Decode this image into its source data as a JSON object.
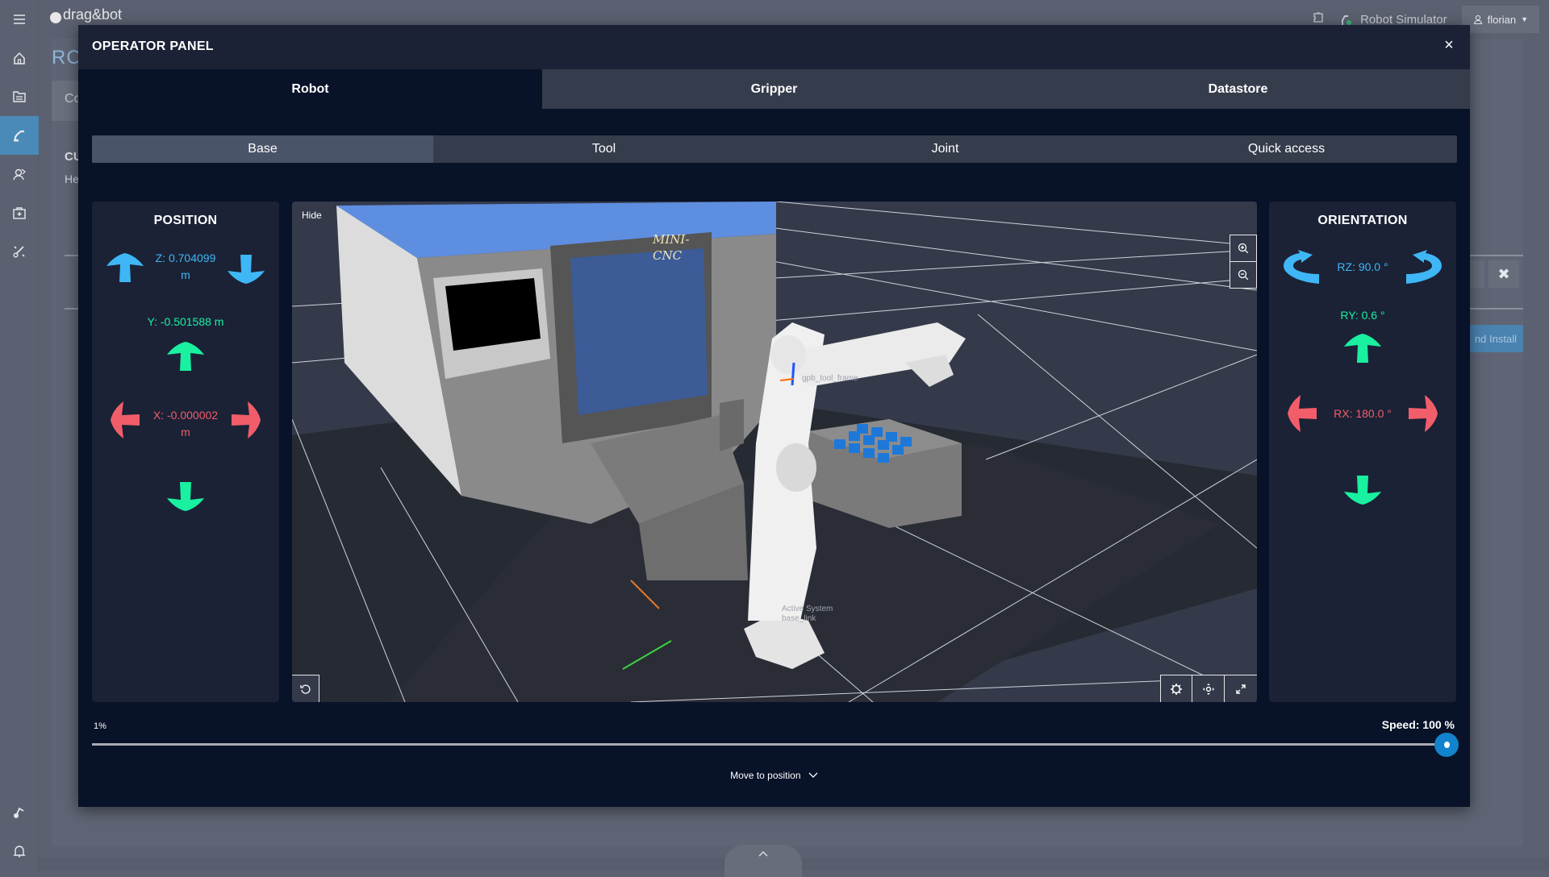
{
  "app": {
    "logo_text": "drag&bot",
    "page_title_partial": "RO",
    "card_text_partial": "Co",
    "section_title_partial": "CU",
    "section_sub_partial": "He",
    "install_button_partial": "nd Install",
    "robot_name": "Robot Simulator",
    "user_name": "florian"
  },
  "sidebar": {
    "items": [
      {
        "icon": "menu-icon"
      },
      {
        "icon": "home-icon"
      },
      {
        "icon": "program-list-icon"
      },
      {
        "icon": "robot-arm-icon",
        "active": true
      },
      {
        "icon": "skills-icon"
      },
      {
        "icon": "toolbox-icon"
      },
      {
        "icon": "tools-icon"
      },
      {
        "icon": "logo-small-icon"
      },
      {
        "icon": "bell-icon"
      }
    ]
  },
  "modal": {
    "title": "OPERATOR PANEL",
    "close_label": "×",
    "tabs": [
      {
        "label": "Robot",
        "active": true
      },
      {
        "label": "Gripper",
        "active": false
      },
      {
        "label": "Datastore",
        "active": false
      }
    ],
    "sub_tabs": [
      {
        "label": "Base",
        "active": true
      },
      {
        "label": "Tool",
        "active": false
      },
      {
        "label": "Joint",
        "active": false
      },
      {
        "label": "Quick access",
        "active": false
      }
    ]
  },
  "position": {
    "title": "POSITION",
    "z_label": "Z: 0.704099",
    "z_unit": "m",
    "y_label": "Y: -0.501588 m",
    "x_label": "X: -0.000002",
    "x_unit": "m"
  },
  "orientation": {
    "title": "ORIENTATION",
    "rz_label": "RZ: 90.0 °",
    "ry_label": "RY: 0.6 °",
    "rx_label": "RX: 180.0 °"
  },
  "viewport": {
    "hide_label": "Hide",
    "machine_label_line1": "MINI-",
    "machine_label_line2": "CNC",
    "tool_frame_label": "gpb_tool_frame",
    "base_label_line1": "Active System",
    "base_label_line2": "base_link"
  },
  "speed": {
    "min_label": "1%",
    "label": "Speed: 100 %",
    "value_percent": 100
  },
  "move_to_position": {
    "label": "Move to position",
    "chevron": "⌄"
  },
  "colors": {
    "z_axis": "#3fb6f5",
    "y_axis": "#19f0a0",
    "x_axis": "#f25d6a",
    "accent": "#1283cc"
  }
}
